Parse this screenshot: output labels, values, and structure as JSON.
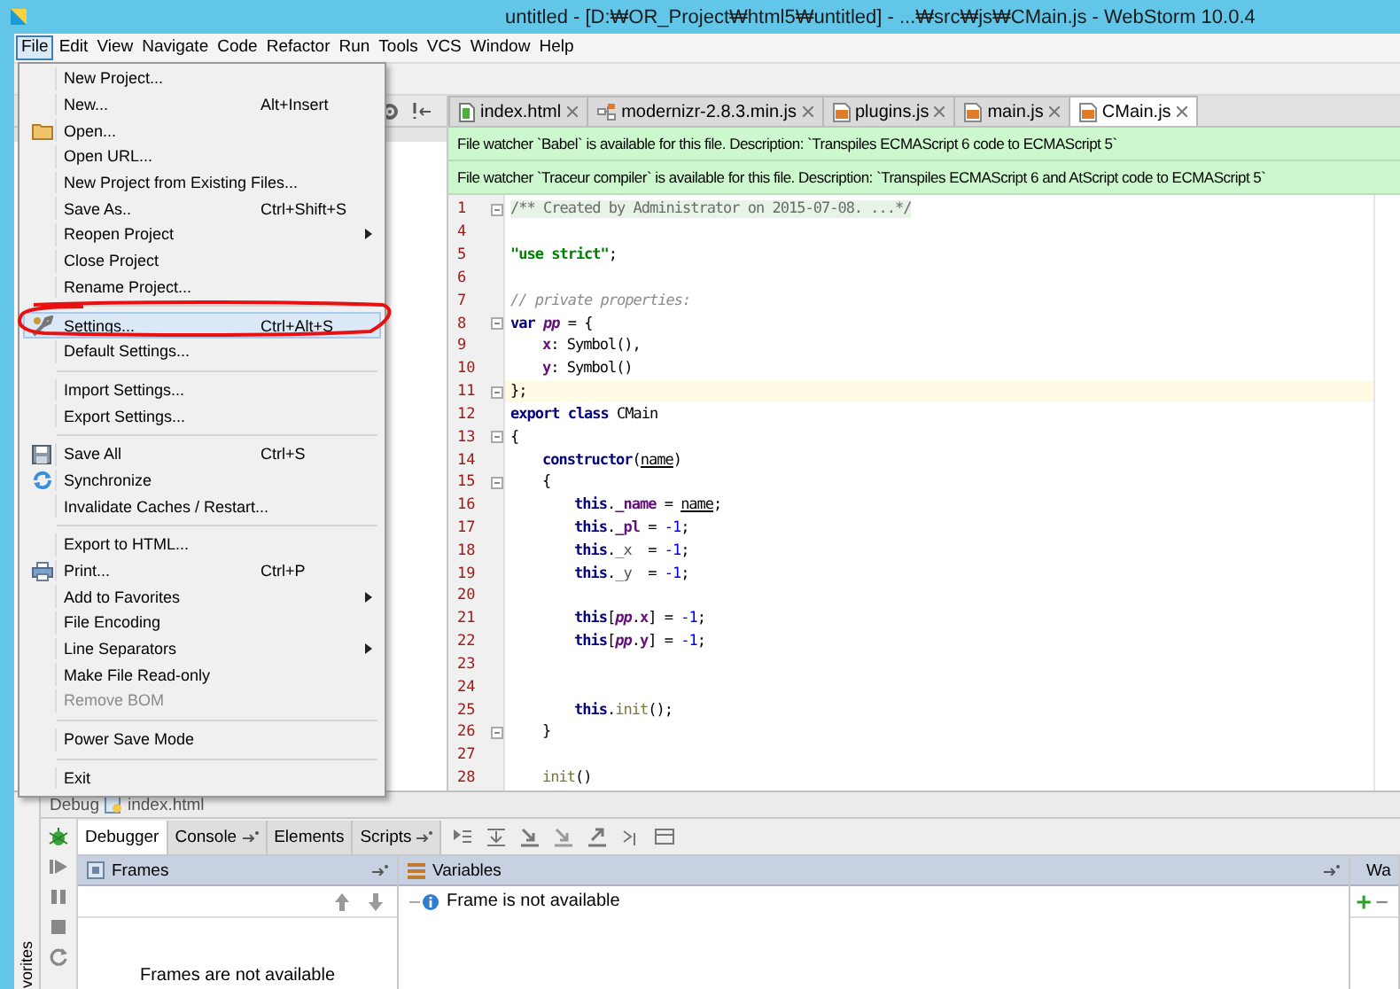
{
  "window": {
    "title": "untitled - [D:₩OR_Project₩html5₩untitled] - ...₩src₩js₩CMain.js - WebStorm 10.0.4"
  },
  "menu_bar": [
    {
      "label": "File",
      "selected": true
    },
    {
      "label": "Edit",
      "selected": false
    },
    {
      "label": "View",
      "selected": false
    },
    {
      "label": "Navigate",
      "selected": false
    },
    {
      "label": "Code",
      "selected": false
    },
    {
      "label": "Refactor",
      "selected": false
    },
    {
      "label": "Run",
      "selected": false
    },
    {
      "label": "Tools",
      "selected": false
    },
    {
      "label": "VCS",
      "selected": false
    },
    {
      "label": "Window",
      "selected": false
    },
    {
      "label": "Help",
      "selected": false
    }
  ],
  "file_menu": {
    "groups": [
      {
        "items": [
          {
            "label": "New Project...",
            "selected": false,
            "disabled": false,
            "submenu": false
          },
          {
            "label": "New...",
            "shortcut": "Alt+Insert",
            "selected": false,
            "disabled": false,
            "submenu": false
          },
          {
            "label": "Open...",
            "selected": false,
            "disabled": false,
            "submenu": false
          },
          {
            "label": "Open URL...",
            "selected": false,
            "disabled": false,
            "submenu": false
          },
          {
            "label": "New Project from Existing Files...",
            "selected": false,
            "disabled": false,
            "submenu": false
          },
          {
            "label": "Save As..",
            "shortcut": "Ctrl+Shift+S",
            "selected": false,
            "disabled": false,
            "submenu": false
          },
          {
            "label": "Reopen Project",
            "selected": false,
            "disabled": false,
            "submenu": true
          },
          {
            "label": "Close Project",
            "selected": false,
            "disabled": false,
            "submenu": false
          },
          {
            "label": "Rename Project...",
            "selected": false,
            "disabled": false,
            "submenu": false
          }
        ]
      },
      {
        "items": [
          {
            "label": "Settings...",
            "shortcut": "Ctrl+Alt+S",
            "selected": true,
            "disabled": false,
            "submenu": false
          },
          {
            "label": "Default Settings...",
            "selected": false,
            "disabled": false,
            "submenu": false
          }
        ]
      },
      {
        "items": [
          {
            "label": "Import Settings...",
            "selected": false,
            "disabled": false,
            "submenu": false
          },
          {
            "label": "Export Settings...",
            "selected": false,
            "disabled": false,
            "submenu": false
          }
        ]
      },
      {
        "items": [
          {
            "label": "Save All",
            "shortcut": "Ctrl+S",
            "selected": false,
            "disabled": false,
            "submenu": false
          },
          {
            "label": "Synchronize",
            "selected": false,
            "disabled": false,
            "submenu": false
          },
          {
            "label": "Invalidate Caches / Restart...",
            "selected": false,
            "disabled": false,
            "submenu": false
          }
        ]
      },
      {
        "items": [
          {
            "label": "Export to HTML...",
            "selected": false,
            "disabled": false,
            "submenu": false
          },
          {
            "label": "Print...",
            "shortcut": "Ctrl+P",
            "selected": false,
            "disabled": false,
            "submenu": false
          },
          {
            "label": "Add to Favorites",
            "selected": false,
            "disabled": false,
            "submenu": true
          },
          {
            "label": "File Encoding",
            "selected": false,
            "disabled": false,
            "submenu": false
          },
          {
            "label": "Line Separators",
            "selected": false,
            "disabled": false,
            "submenu": true
          },
          {
            "label": "Make File Read-only",
            "selected": false,
            "disabled": false,
            "submenu": false
          },
          {
            "label": "Remove BOM",
            "selected": false,
            "disabled": true,
            "submenu": false
          }
        ]
      },
      {
        "items": [
          {
            "label": "Power Save Mode",
            "selected": false,
            "disabled": false,
            "submenu": false
          }
        ]
      },
      {
        "items": [
          {
            "label": "Exit",
            "selected": false,
            "disabled": false,
            "submenu": false
          }
        ]
      }
    ]
  },
  "editor": {
    "tabs": [
      {
        "label": "index.html",
        "kind": "html",
        "selected": false
      },
      {
        "label": "modernizr-2.8.3.min.js",
        "kind": "lib",
        "selected": false
      },
      {
        "label": "plugins.js",
        "kind": "js",
        "selected": false
      },
      {
        "label": "main.js",
        "kind": "js",
        "selected": false
      },
      {
        "label": "CMain.js",
        "kind": "js",
        "selected": true
      }
    ],
    "banners": [
      "File watcher `Babel` is available for this file. Description: `Transpiles ECMAScript 6 code to ECMAScript 5`",
      "File watcher `Traceur compiler` is available for this file. Description: `Transpiles ECMAScript 6 and AtScript code to ECMAScript 5`"
    ],
    "lines": [
      {
        "number": "1",
        "kind": "top",
        "fold": true,
        "current": false,
        "tokens": [
          {
            "text": "/** Created by Administrator on 2015-07-08. ...*/",
            "kind": "folded"
          }
        ]
      },
      {
        "number": "4",
        "kind": "blank",
        "fold": false,
        "current": false
      },
      {
        "number": "5",
        "kind": "top",
        "fold": false,
        "current": false,
        "tokens": [
          {
            "text": "\"use strict\"",
            "kind": "string"
          },
          {
            "text": ";",
            "kind": "plain"
          }
        ]
      },
      {
        "number": "6",
        "kind": "blank",
        "fold": false,
        "current": false
      },
      {
        "number": "7",
        "kind": "top",
        "fold": false,
        "current": false,
        "tokens": [
          {
            "text": "// private properties:",
            "kind": "comment"
          }
        ]
      },
      {
        "number": "8",
        "kind": "top",
        "fold": true,
        "current": false,
        "tokens": [
          {
            "text": "var",
            "kind": "keyword"
          },
          {
            "text": " pp",
            "kind": "field_italic"
          },
          {
            "text": " = {",
            "kind": "plain"
          }
        ]
      },
      {
        "number": "9",
        "kind": "member",
        "fold": false,
        "current": false,
        "tokens": [
          {
            "text": "x",
            "kind": "field"
          },
          {
            "text": ": Symbol(),",
            "kind": "plain"
          }
        ]
      },
      {
        "number": "10",
        "kind": "member",
        "fold": false,
        "current": false,
        "tokens": [
          {
            "text": "y",
            "kind": "field"
          },
          {
            "text": ": Symbol()",
            "kind": "plain"
          }
        ]
      },
      {
        "number": "11",
        "kind": "top",
        "fold": true,
        "current": true,
        "tokens": [
          {
            "text": "};",
            "kind": "plain"
          }
        ]
      },
      {
        "number": "12",
        "kind": "top",
        "fold": false,
        "current": false,
        "tokens": [
          {
            "text": "export class",
            "kind": "keyword"
          },
          {
            "text": " CMain",
            "kind": "plain"
          }
        ]
      },
      {
        "number": "13",
        "kind": "top",
        "fold": true,
        "current": false,
        "tokens": [
          {
            "text": "{",
            "kind": "plain"
          }
        ]
      },
      {
        "number": "14",
        "kind": "member",
        "fold": false,
        "current": false,
        "tokens": [
          {
            "text": "constructor",
            "kind": "keyword"
          },
          {
            "text": "(",
            "kind": "plain"
          },
          {
            "text": "name",
            "kind": "param"
          },
          {
            "text": ")",
            "kind": "plain"
          }
        ]
      },
      {
        "number": "15",
        "kind": "member",
        "fold": true,
        "current": false,
        "tokens": [
          {
            "text": "{",
            "kind": "plain"
          }
        ]
      },
      {
        "number": "16",
        "kind": "body",
        "fold": false,
        "current": false,
        "tokens": [
          {
            "text": "this",
            "kind": "keyword"
          },
          {
            "text": ".",
            "kind": "plain"
          },
          {
            "text": "_name",
            "kind": "field"
          },
          {
            "text": " = ",
            "kind": "plain"
          },
          {
            "text": "name",
            "kind": "param"
          },
          {
            "text": ";",
            "kind": "plain"
          }
        ]
      },
      {
        "number": "17",
        "kind": "body",
        "fold": false,
        "current": false,
        "tokens": [
          {
            "text": "this",
            "kind": "keyword"
          },
          {
            "text": ".",
            "kind": "plain"
          },
          {
            "text": "_pl",
            "kind": "field"
          },
          {
            "text": " = ",
            "kind": "plain"
          },
          {
            "text": "-1",
            "kind": "number"
          },
          {
            "text": ";",
            "kind": "plain"
          }
        ]
      },
      {
        "number": "18",
        "kind": "body",
        "fold": false,
        "current": false,
        "tokens": [
          {
            "text": "this",
            "kind": "keyword"
          },
          {
            "text": ".",
            "kind": "plain"
          },
          {
            "text": "_x",
            "kind": "dim"
          },
          {
            "text": "  = ",
            "kind": "plain"
          },
          {
            "text": "-1",
            "kind": "number"
          },
          {
            "text": ";",
            "kind": "plain"
          }
        ]
      },
      {
        "number": "19",
        "kind": "body",
        "fold": false,
        "current": false,
        "tokens": [
          {
            "text": "this",
            "kind": "keyword"
          },
          {
            "text": ".",
            "kind": "plain"
          },
          {
            "text": "_y",
            "kind": "dim"
          },
          {
            "text": "  = ",
            "kind": "plain"
          },
          {
            "text": "-1",
            "kind": "number"
          },
          {
            "text": ";",
            "kind": "plain"
          }
        ]
      },
      {
        "number": "20",
        "kind": "blank",
        "fold": false,
        "current": false
      },
      {
        "number": "21",
        "kind": "body",
        "fold": false,
        "current": false,
        "tokens": [
          {
            "text": "this",
            "kind": "keyword"
          },
          {
            "text": "[",
            "kind": "plain"
          },
          {
            "text": "pp",
            "kind": "field_italic"
          },
          {
            "text": ".",
            "kind": "plain"
          },
          {
            "text": "x",
            "kind": "field"
          },
          {
            "text": "] = ",
            "kind": "plain"
          },
          {
            "text": "-1",
            "kind": "number"
          },
          {
            "text": ";",
            "kind": "plain"
          }
        ]
      },
      {
        "number": "22",
        "kind": "body",
        "fold": false,
        "current": false,
        "tokens": [
          {
            "text": "this",
            "kind": "keyword"
          },
          {
            "text": "[",
            "kind": "plain"
          },
          {
            "text": "pp",
            "kind": "field_italic"
          },
          {
            "text": ".",
            "kind": "plain"
          },
          {
            "text": "y",
            "kind": "field"
          },
          {
            "text": "] = ",
            "kind": "plain"
          },
          {
            "text": "-1",
            "kind": "number"
          },
          {
            "text": ";",
            "kind": "plain"
          }
        ]
      },
      {
        "number": "23",
        "kind": "blank",
        "fold": false,
        "current": false
      },
      {
        "number": "24",
        "kind": "blank",
        "fold": false,
        "current": false
      },
      {
        "number": "25",
        "kind": "body",
        "fold": false,
        "current": false,
        "tokens": [
          {
            "text": "this",
            "kind": "keyword"
          },
          {
            "text": ".",
            "kind": "plain"
          },
          {
            "text": "init",
            "kind": "call"
          },
          {
            "text": "();",
            "kind": "plain"
          }
        ]
      },
      {
        "number": "26",
        "kind": "member",
        "fold": true,
        "current": false,
        "tokens": [
          {
            "text": "}",
            "kind": "plain"
          }
        ]
      },
      {
        "number": "27",
        "kind": "blank",
        "fold": false,
        "current": false
      },
      {
        "number": "28",
        "kind": "member",
        "fold": false,
        "current": false,
        "tokens": [
          {
            "text": "init",
            "kind": "call"
          },
          {
            "text": "()",
            "kind": "plain"
          }
        ]
      }
    ]
  },
  "debug_panel": {
    "title": "Debug",
    "configuration": "index.html",
    "tabs": [
      {
        "label": "Debugger",
        "selected": true,
        "pinned": false
      },
      {
        "label": "Console",
        "selected": false,
        "pinned": true
      },
      {
        "label": "Elements",
        "selected": false,
        "pinned": false
      },
      {
        "label": "Scripts",
        "selected": false,
        "pinned": true
      }
    ],
    "frames": {
      "title": "Frames",
      "empty_text": "Frames are not available"
    },
    "variables": {
      "title": "Variables",
      "message": "Frame is not available"
    },
    "watches": {
      "title": "Wa"
    }
  },
  "favorites": {
    "label": "vorites"
  }
}
